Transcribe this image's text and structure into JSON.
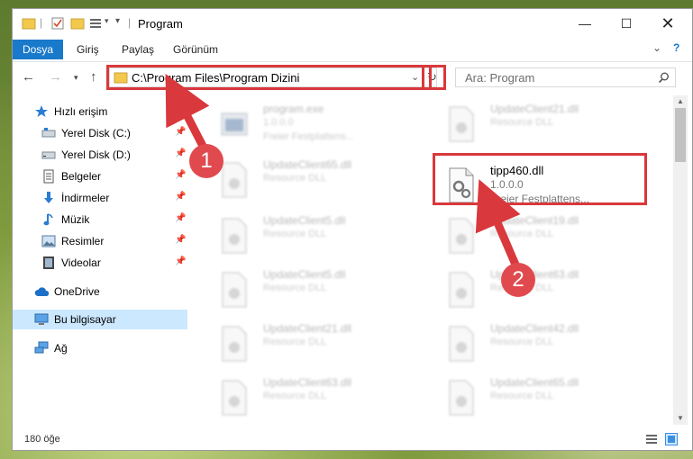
{
  "window": {
    "title": "Program"
  },
  "ribbon": {
    "tabs": [
      "Dosya",
      "Giriş",
      "Paylaş",
      "Görünüm"
    ]
  },
  "address": {
    "path": "C:\\Program Files\\Program Dizini"
  },
  "search": {
    "placeholder": "Ara: Program"
  },
  "sidebar": {
    "items": [
      {
        "label": "Hızlı erişim",
        "icon": "star-icon"
      },
      {
        "label": "Yerel Disk (C:)",
        "icon": "drive-icon"
      },
      {
        "label": "Yerel Disk (D:)",
        "icon": "drive-icon"
      },
      {
        "label": "Belgeler",
        "icon": "documents-icon"
      },
      {
        "label": "İndirmeler",
        "icon": "download-icon"
      },
      {
        "label": "Müzik",
        "icon": "music-icon"
      },
      {
        "label": "Resimler",
        "icon": "pictures-icon"
      },
      {
        "label": "Videolar",
        "icon": "video-icon"
      },
      {
        "label": "OneDrive",
        "icon": "cloud-icon"
      },
      {
        "label": "Bu bilgisayar",
        "icon": "computer-icon"
      },
      {
        "label": "Ağ",
        "icon": "network-icon"
      }
    ]
  },
  "files": [
    {
      "name": "program.exe",
      "line1": "1.0.0.0",
      "line2": "Freier Festplattens..."
    },
    {
      "name": "UpdateClient21.dll",
      "line1": "Resource DLL",
      "line2": ""
    },
    {
      "name": "UpdateClient65.dll",
      "line1": "Resource DLL",
      "line2": ""
    },
    {
      "name": "tipp460.dll",
      "line1": "1.0.0.0",
      "line2": "Freier Festplattens..."
    },
    {
      "name": "UpdateClient5.dll",
      "line1": "Resource DLL",
      "line2": ""
    },
    {
      "name": "UpdateClient19.dll",
      "line1": "Resource DLL",
      "line2": ""
    },
    {
      "name": "UpdateClient5.dll",
      "line1": "Resource DLL",
      "line2": ""
    },
    {
      "name": "UpdateClient63.dll",
      "line1": "Resource DLL",
      "line2": ""
    },
    {
      "name": "UpdateClient21.dll",
      "line1": "Resource DLL",
      "line2": ""
    },
    {
      "name": "UpdateClient42.dll",
      "line1": "Resource DLL",
      "line2": ""
    },
    {
      "name": "UpdateClient63.dll",
      "line1": "Resource DLL",
      "line2": ""
    },
    {
      "name": "UpdateClient65.dll",
      "line1": "Resource DLL",
      "line2": ""
    }
  ],
  "status": {
    "count": "180 öğe"
  },
  "badges": {
    "one": "1",
    "two": "2"
  },
  "colors": {
    "accent": "#1979ca",
    "highlight": "#d9383c",
    "selected": "#cce8ff"
  }
}
